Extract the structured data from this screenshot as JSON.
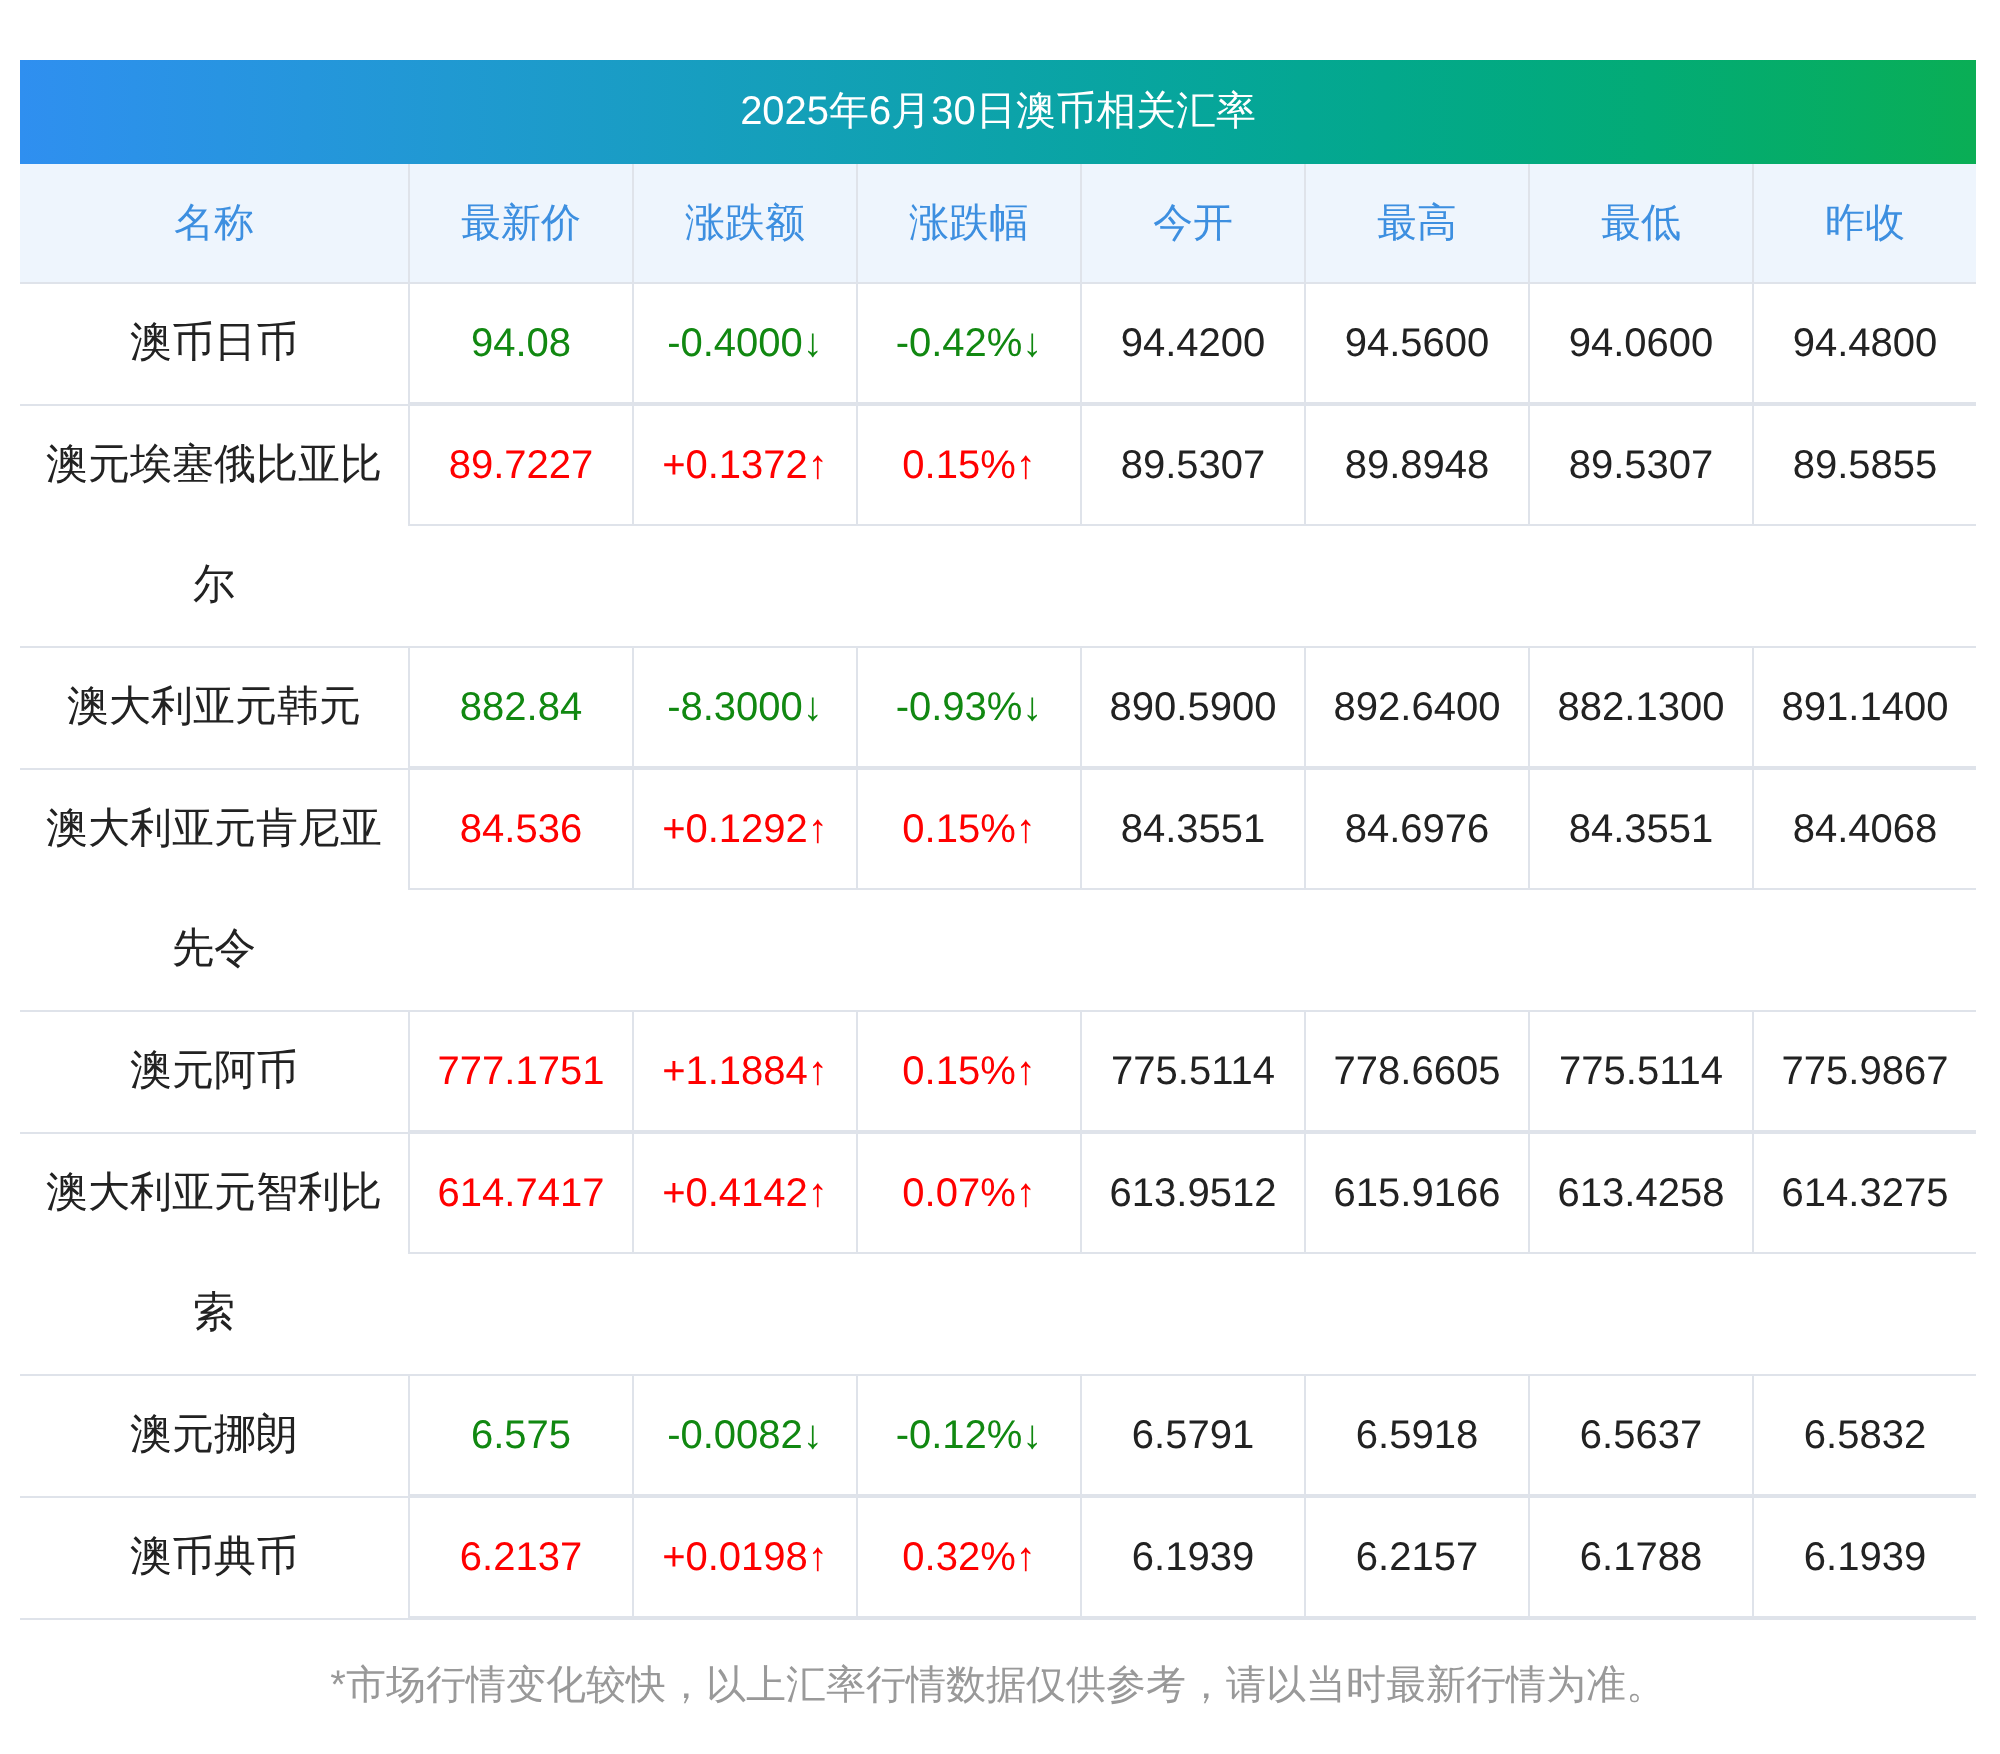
{
  "title": "2025年6月30日澳币相关汇率",
  "columns": [
    "名称",
    "最新价",
    "涨跌额",
    "涨跌幅",
    "今开",
    "最高",
    "最低",
    "昨收"
  ],
  "rows": [
    {
      "name": "澳币日币",
      "color": "#118811",
      "cells": [
        "94.08",
        "-0.4000↓",
        "-0.42%↓",
        "94.4200",
        "94.5600",
        "94.0600",
        "94.4800"
      ]
    },
    {
      "name": "澳元埃塞俄比亚比尔",
      "color": "#ff0000",
      "cells": [
        "89.7227",
        "+0.1372↑",
        "0.15%↑",
        "89.5307",
        "89.8948",
        "89.5307",
        "89.5855"
      ]
    },
    {
      "name": "澳大利亚元韩元",
      "color": "#118811",
      "cells": [
        "882.84",
        "-8.3000↓",
        "-0.93%↓",
        "890.5900",
        "892.6400",
        "882.1300",
        "891.1400"
      ]
    },
    {
      "name": "澳大利亚元肯尼亚先令",
      "color": "#ff0000",
      "cells": [
        "84.536",
        "+0.1292↑",
        "0.15%↑",
        "84.3551",
        "84.6976",
        "84.3551",
        "84.4068"
      ]
    },
    {
      "name": "澳元阿币",
      "color": "#ff0000",
      "cells": [
        "777.1751",
        "+1.1884↑",
        "0.15%↑",
        "775.5114",
        "778.6605",
        "775.5114",
        "775.9867"
      ]
    },
    {
      "name": "澳大利亚元智利比索",
      "color": "#ff0000",
      "cells": [
        "614.7417",
        "+0.4142↑",
        "0.07%↑",
        "613.9512",
        "615.9166",
        "613.4258",
        "614.3275"
      ]
    },
    {
      "name": "澳元挪朗",
      "color": "#118811",
      "cells": [
        "6.575",
        "-0.0082↓",
        "-0.12%↓",
        "6.5791",
        "6.5918",
        "6.5637",
        "6.5832"
      ]
    },
    {
      "name": "澳币典币",
      "color": "#ff0000",
      "cells": [
        "6.2137",
        "+0.0198↑",
        "0.32%↑",
        "6.1939",
        "6.2157",
        "6.1788",
        "6.1939"
      ]
    }
  ],
  "footnote": "*市场行情变化较快，以上汇率行情数据仅供参考，请以当时最新行情为准。"
}
